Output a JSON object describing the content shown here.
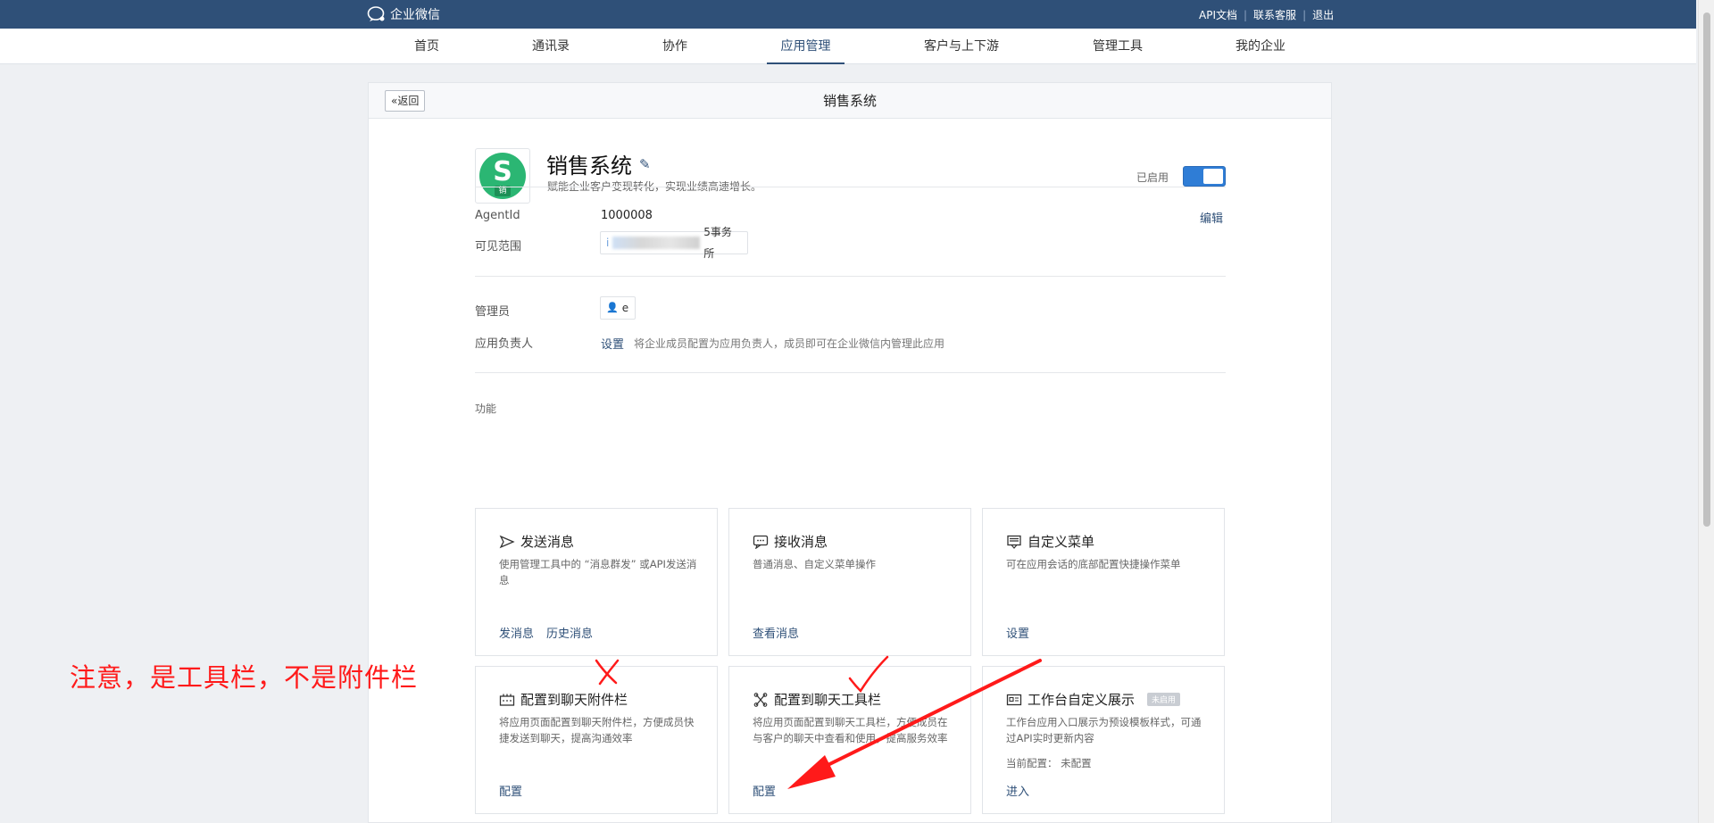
{
  "topbar": {
    "brand": "企业微信",
    "links": [
      "API文档",
      "联系客服",
      "退出"
    ]
  },
  "nav": {
    "items": [
      "首页",
      "通讯录",
      "协作",
      "应用管理",
      "客户与上下游",
      "管理工具",
      "我的企业"
    ],
    "active": "应用管理"
  },
  "header": {
    "back_label": "返回",
    "title": "销售系统"
  },
  "app": {
    "icon_glyph": "S",
    "icon_tag": "销",
    "name": "销售系统",
    "description": "赋能企业客户变现转化，实现业绩高速增长。",
    "status_label": "已启用",
    "enabled": true
  },
  "details": {
    "agentid_label": "AgentId",
    "agentid_value": "1000008",
    "edit_label": "编辑",
    "scope_label": "可见范围",
    "scope_prefix": "i",
    "scope_suffix": "5事务所",
    "admin_label": "管理员",
    "admin_value": "e",
    "owner_label": "应用负责人",
    "owner_link": "设置",
    "owner_hint": "将企业成员配置为应用负责人，成员即可在企业微信内管理此应用"
  },
  "features": {
    "section_label": "功能",
    "send": {
      "title": "发送消息",
      "desc": "使用管理工具中的 “消息群发” 或API发送消息",
      "actions": [
        "发消息",
        "历史消息"
      ]
    },
    "receive": {
      "title": "接收消息",
      "desc": "普通消息、自定义菜单操作",
      "actions": [
        "查看消息"
      ]
    },
    "menu": {
      "title": "自定义菜单",
      "desc": "可在应用会话的底部配置快捷操作菜单",
      "actions": [
        "设置"
      ]
    },
    "attach": {
      "title": "配置到聊天附件栏",
      "desc": "将应用页面配置到聊天附件栏，方便成员快捷发送到聊天，提高沟通效率",
      "actions": [
        "配置"
      ]
    },
    "toolbar": {
      "title": "配置到聊天工具栏",
      "desc": "将应用页面配置到聊天工具栏，方便成员在与客户的聊天中查看和使用，提高服务效率",
      "actions": [
        "配置"
      ]
    },
    "workbench": {
      "title": "工作台自定义展示",
      "badge": "未启用",
      "desc": "工作台应用入口展示为预设模板样式，可通过API实时更新内容",
      "status": "当前配置： 未配置",
      "actions": [
        "进入"
      ]
    }
  },
  "annotation": {
    "note": "注意，是工具栏，不是附件栏",
    "color": "#ff1a1a"
  }
}
